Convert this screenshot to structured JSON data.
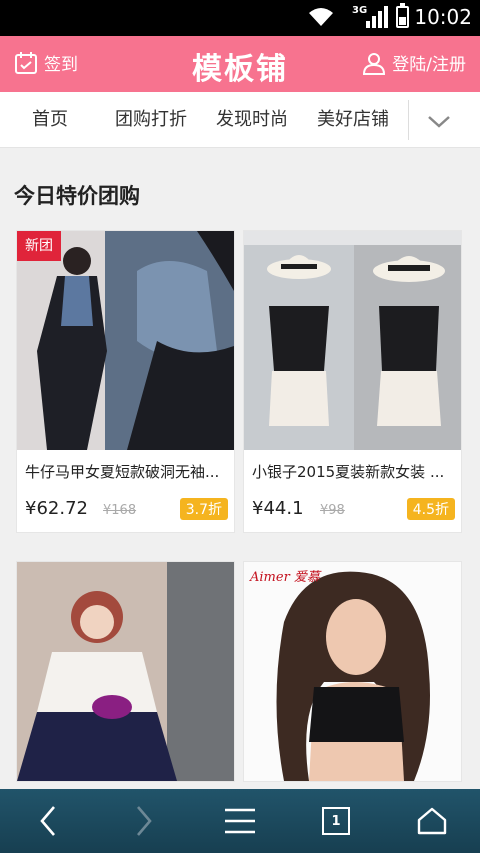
{
  "status": {
    "network": "3G",
    "time": "10:02"
  },
  "header": {
    "signin_label": "签到",
    "title": "模板铺",
    "login_label": "登陆/注册"
  },
  "nav": {
    "items": [
      "首页",
      "团购打折",
      "发现时尚",
      "美好店铺"
    ]
  },
  "section": {
    "title": "今日特价团购"
  },
  "products": [
    {
      "tag": "新团",
      "name": "牛仔马甲女夏短款破洞无袖...",
      "price": "¥62.72",
      "original": "¥168",
      "discount": "3.7折"
    },
    {
      "name": "小银子2015夏装新款女装 ...",
      "price": "¥44.1",
      "original": "¥98",
      "discount": "4.5折"
    },
    {},
    {
      "brand_text": "Aimer 爱慕"
    }
  ],
  "bottombar": {
    "tab_count": "1"
  },
  "colors": {
    "header": "#f7738f",
    "discount": "#f5b41f",
    "new_tag": "#e0243a",
    "bottombar": "#1c4a5e"
  }
}
